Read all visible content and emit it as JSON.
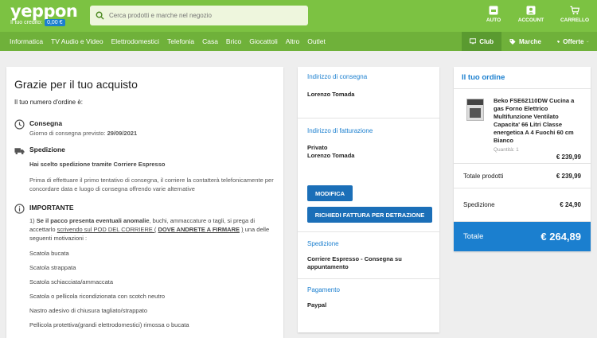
{
  "header": {
    "logo": "yeppon",
    "credit_label": "Il tuo credito:",
    "credit_value": "0,00 €",
    "search_placeholder": "Cerca prodotti e marche nel negozio",
    "auto_label": "AUTO",
    "account_label": "ACCOUNT",
    "cart_label": "CARRELLO"
  },
  "nav": {
    "items": [
      "Informatica",
      "TV Audio e Video",
      "Elettrodomestici",
      "Telefonia",
      "Casa",
      "Brico",
      "Giocattoli",
      "Altro",
      "Outlet"
    ],
    "club": "Club",
    "marche": "Marche",
    "offerte": "Offerte"
  },
  "thanks": {
    "title": "Grazie per il tuo acquisto",
    "order_number_label": "Il tuo numero d'ordine è:",
    "consegna_title": "Consegna",
    "consegna_sub_label": "Giorno di consegna previsto:",
    "consegna_date": "29/09/2021",
    "spedizione_title": "Spedizione",
    "spedizione_bold": "Hai scelto spedizione tramite Corriere Espresso",
    "spedizione_text": "Prima di effettuare il primo tentativo di consegna, il corriere la contatterà telefonicamente per concordare data e luogo di consegna offrendo varie alternative",
    "important_title": "IMPORTANTE",
    "important_num": "1)",
    "important_bold": "Se il pacco presenta eventuali anomalie",
    "important_mid": ", buchi, ammaccature o tagli, si prega di accettarlo",
    "important_underline1": "scrivendo sul POD DEL CORRIERE (",
    "important_underline2": "DOVE ANDRETE A FIRMARE",
    "important_underline3": ")",
    "important_end": "una delle seguenti motivazioni :",
    "reasons": [
      "Scatola bucata",
      "Scatola strappata",
      "Scatola schiacciata/ammaccata",
      "Scatola o pellicola ricondizionata con scotch neutro",
      "Nastro adesivo di chiusura tagliato/strappato",
      "Pellicola protettiva(grandi elettrodomestici) rimossa o bucata"
    ]
  },
  "address": {
    "consegna_label": "Indirizzo di consegna",
    "consegna_name": "Lorenzo Tomada",
    "fatturazione_label": "Indirizzo di fatturazione",
    "fatturazione_type": "Privato",
    "fatturazione_name": "Lorenzo Tomada",
    "modifica_btn": "MODIFICA",
    "fattura_btn": "RICHIEDI FATTURA PER DETRAZIONE",
    "spedizione_label": "Spedizione",
    "spedizione_value": "Corriere Espresso - Consegna su appuntamento",
    "pagamento_label": "Pagamento",
    "pagamento_value": "Paypal"
  },
  "order": {
    "title": "Il tuo ordine",
    "product_name": "Beko FSE62110DW Cucina a gas Forno Elettrico Multifunzione Ventilato Capacita' 66 Litri Classe energetica A 4 Fuochi 60 cm Bianco",
    "product_qty": "Quantità: 1",
    "product_price": "€ 239,99",
    "totale_prodotti_label": "Totale prodotti",
    "totale_prodotti_value": "€ 239,99",
    "spedizione_label": "Spedizione",
    "spedizione_value": "€ 24,90",
    "totale_label": "Totale",
    "totale_value": "€ 264,89"
  },
  "colors": {
    "brand_green": "#7cc242",
    "nav_green": "#6fb13a",
    "accent_blue": "#1b7fcf"
  }
}
